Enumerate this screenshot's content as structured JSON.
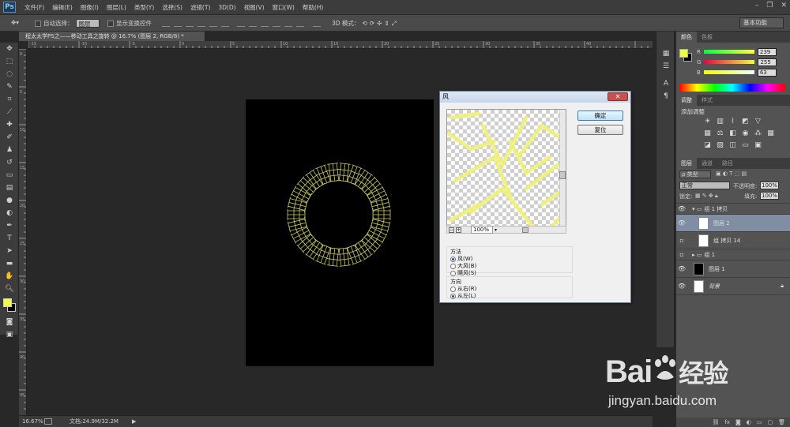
{
  "app": {
    "logo": "Ps"
  },
  "menu": [
    "文件(F)",
    "编辑(E)",
    "图像(I)",
    "图层(L)",
    "类型(Y)",
    "选择(S)",
    "滤镜(T)",
    "3D(D)",
    "视图(V)",
    "窗口(W)",
    "帮助(H)"
  ],
  "options": {
    "auto_select_label": "自动选择：",
    "auto_select_value": "图层",
    "show_transform_label": "显示变换控件",
    "mode_3d_label": "3D 模式：",
    "workspace": "基本功能"
  },
  "document": {
    "tab_title": "程太太学PS之——移动工具之旋转 @ 16.7% (图层 2, RGB/8) *"
  },
  "status": {
    "zoom": "16.67%",
    "doc_info": "文档:24.9M/32.2M"
  },
  "ruler_h": [
    "-15",
    "-10",
    "-5",
    "0",
    "5",
    "10",
    "15",
    "20",
    "25",
    "30",
    "35",
    "40"
  ],
  "ruler_v": [
    "0",
    "5",
    "10",
    "15",
    "20",
    "25",
    "30",
    "35",
    "40",
    "45"
  ],
  "color_panel": {
    "tabs": [
      "颜色",
      "色板"
    ],
    "r_label": "R",
    "g_label": "G",
    "b_label": "B",
    "r": "239",
    "g": "255",
    "b": "63",
    "fg_color": "#efff3f"
  },
  "adjust_panel": {
    "tabs": [
      "调整",
      "样式"
    ],
    "title": "添加调整"
  },
  "layers_panel": {
    "tabs": [
      "图层",
      "通道",
      "路径"
    ],
    "kind_label": "ρ 类型",
    "blend_mode": "正常",
    "opacity_label": "不透明度:",
    "opacity": "100%",
    "lock_label": "锁定:",
    "fill_label": "填充:",
    "fill": "100%",
    "layers": [
      {
        "name": "组 1 拷贝",
        "type": "group",
        "visible": true
      },
      {
        "name": "图层 2",
        "type": "layer",
        "visible": true,
        "selected": true
      },
      {
        "name": "组 拷贝 14",
        "type": "layer",
        "visible": false
      },
      {
        "name": "组 1",
        "type": "group",
        "visible": false
      },
      {
        "name": "图层 1",
        "type": "black",
        "visible": true
      },
      {
        "name": "背景",
        "type": "white",
        "visible": true
      }
    ]
  },
  "dialog": {
    "title": "风",
    "ok": "确定",
    "reset": "复位",
    "zoom": "100%",
    "method_label": "方法",
    "methods": [
      "风(W)",
      "大风(B)",
      "飓风(S)"
    ],
    "direction_label": "方向",
    "directions": [
      "从右(R)",
      "从左(L)"
    ]
  },
  "watermark": {
    "brand": "Bai",
    "brand_suffix": "经验",
    "url": "jingyan.baidu.com"
  }
}
